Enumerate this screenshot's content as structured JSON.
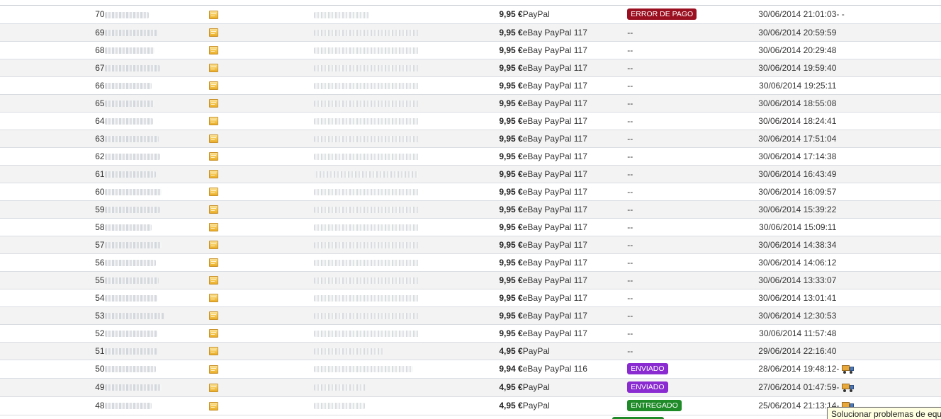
{
  "colors": {
    "error": "#9b1021",
    "sent": "#8a2bd1",
    "delivered": "#1e8a28"
  },
  "icons": {
    "note": "note-icon",
    "shipping": "truck-icon"
  },
  "orders": [
    {
      "id": "70",
      "price": "9,95 €",
      "payment": "PayPal",
      "status": "ERROR DE PAGO",
      "status_type": "error",
      "date": "30/06/2014 21:01:03",
      "action": "-  -"
    },
    {
      "id": "69",
      "price": "9,95 €",
      "payment": "eBay PayPal 117",
      "status": "--",
      "status_type": "none",
      "date": "30/06/2014 20:59:59",
      "action": ""
    },
    {
      "id": "68",
      "price": "9,95 €",
      "payment": "eBay PayPal 117",
      "status": "--",
      "status_type": "none",
      "date": "30/06/2014 20:29:48",
      "action": ""
    },
    {
      "id": "67",
      "price": "9,95 €",
      "payment": "eBay PayPal 117",
      "status": "--",
      "status_type": "none",
      "date": "30/06/2014 19:59:40",
      "action": ""
    },
    {
      "id": "66",
      "price": "9,95 €",
      "payment": "eBay PayPal 117",
      "status": "--",
      "status_type": "none",
      "date": "30/06/2014 19:25:11",
      "action": ""
    },
    {
      "id": "65",
      "price": "9,95 €",
      "payment": "eBay PayPal 117",
      "status": "--",
      "status_type": "none",
      "date": "30/06/2014 18:55:08",
      "action": ""
    },
    {
      "id": "64",
      "price": "9,95 €",
      "payment": "eBay PayPal 117",
      "status": "--",
      "status_type": "none",
      "date": "30/06/2014 18:24:41",
      "action": ""
    },
    {
      "id": "63",
      "price": "9,95 €",
      "payment": "eBay PayPal 117",
      "status": "--",
      "status_type": "none",
      "date": "30/06/2014 17:51:04",
      "action": ""
    },
    {
      "id": "62",
      "price": "9,95 €",
      "payment": "eBay PayPal 117",
      "status": "--",
      "status_type": "none",
      "date": "30/06/2014 17:14:38",
      "action": ""
    },
    {
      "id": "61",
      "price": "9,95 €",
      "payment": "eBay PayPal 117",
      "status": "--",
      "status_type": "none",
      "date": "30/06/2014 16:43:49",
      "action": ""
    },
    {
      "id": "60",
      "price": "9,95 €",
      "payment": "eBay PayPal 117",
      "status": "--",
      "status_type": "none",
      "date": "30/06/2014 16:09:57",
      "action": ""
    },
    {
      "id": "59",
      "price": "9,95 €",
      "payment": "eBay PayPal 117",
      "status": "--",
      "status_type": "none",
      "date": "30/06/2014 15:39:22",
      "action": ""
    },
    {
      "id": "58",
      "price": "9,95 €",
      "payment": "eBay PayPal 117",
      "status": "--",
      "status_type": "none",
      "date": "30/06/2014 15:09:11",
      "action": ""
    },
    {
      "id": "57",
      "price": "9,95 €",
      "payment": "eBay PayPal 117",
      "status": "--",
      "status_type": "none",
      "date": "30/06/2014 14:38:34",
      "action": ""
    },
    {
      "id": "56",
      "price": "9,95 €",
      "payment": "eBay PayPal 117",
      "status": "--",
      "status_type": "none",
      "date": "30/06/2014 14:06:12",
      "action": ""
    },
    {
      "id": "55",
      "price": "9,95 €",
      "payment": "eBay PayPal 117",
      "status": "--",
      "status_type": "none",
      "date": "30/06/2014 13:33:07",
      "action": ""
    },
    {
      "id": "54",
      "price": "9,95 €",
      "payment": "eBay PayPal 117",
      "status": "--",
      "status_type": "none",
      "date": "30/06/2014 13:01:41",
      "action": ""
    },
    {
      "id": "53",
      "price": "9,95 €",
      "payment": "eBay PayPal 117",
      "status": "--",
      "status_type": "none",
      "date": "30/06/2014 12:30:53",
      "action": ""
    },
    {
      "id": "52",
      "price": "9,95 €",
      "payment": "eBay PayPal 117",
      "status": "--",
      "status_type": "none",
      "date": "30/06/2014 11:57:48",
      "action": ""
    },
    {
      "id": "51",
      "price": "4,95 €",
      "payment": "PayPal",
      "status": "--",
      "status_type": "none",
      "date": "29/06/2014 22:16:40",
      "action": ""
    },
    {
      "id": "50",
      "price": "9,94 €",
      "payment": "eBay PayPal 116",
      "status": "ENVIADO",
      "status_type": "sent",
      "date": "28/06/2014 19:48:12",
      "action": "-"
    },
    {
      "id": "49",
      "price": "4,95 €",
      "payment": "PayPal",
      "status": "ENVIADO",
      "status_type": "sent",
      "date": "27/06/2014 01:47:59",
      "action": "-"
    },
    {
      "id": "48",
      "price": "4,95 €",
      "payment": "PayPal",
      "status": "ENTREGADO",
      "status_type": "delivered",
      "date": "25/06/2014 21:13:14",
      "action": "-"
    }
  ],
  "tooltip": {
    "text": "Solucionar problemas de equ"
  }
}
